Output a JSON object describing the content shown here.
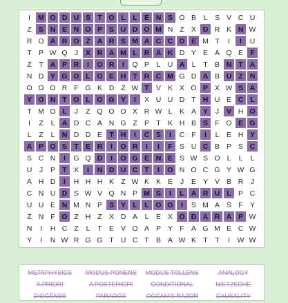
{
  "grid_rows": [
    "IMODUSTOLLENSOBLSVCU",
    "ZSNENOPSUDOMNZXDRKNW",
    "ROAROZARSMACCOEMTIIU",
    "TPWQJXRAMLRAKDYEAQEF",
    "ZTAPRIORIQPLUALTBNTA",
    "NDYGOLOEHTRCMGDABUZN",
    "OOORFGKDZWTVKXOPXWSA",
    "YONTOLOGYIXUUDTHUECL",
    "TMOLJZQOOXRWLKAYJVHO",
    "IZLADCANGZPTKHBSFOEG",
    "LZLNDDETHICSICFILEHY",
    "APOSTERIORIIFSUCBPSC",
    "SCNIGQDIOGENESWSOLLL",
    "UJPTXINDUCTIONOCGYWG",
    "AHDIHHHKZWKKEJEYVBRJ",
    "CNUDSWVQNPMSILARULPC",
    "UUENMNPSYLLOGISMASFY",
    "ZNFOZHZXDALEXODARAPW",
    "NIHCZLTEVOAPYFAGMECW",
    "YINWRGGTUCTBAWKTTIWW"
  ],
  "highlight_rows": [
    "01111111111110000000",
    "01111111111100010010",
    "00111111111111100010",
    "00000111111110000001",
    "00111111100001000111",
    "00111111111110010111",
    "00000000001000010011",
    "11111111110000010011",
    "00010000000000010101",
    "00010000000000010011",
    "00010001111110010001",
    "11111111111110010001",
    "00010011111110000000",
    "00010111111110000000",
    "00010000000000000000",
    "00010000001111111100",
    "00010001111111000000",
    "00010000000001111110",
    "00000000000000000000",
    "00000000000000000000"
  ],
  "word_list": [
    "METAPHYSICS",
    "MODUS PONENS",
    "MODUS TOLLENS",
    "ANALOGY",
    "A PRIORI",
    "A POSTERIORI",
    "CONDITIONAL",
    "NIETZSCHE",
    "DIOGENES",
    "PARADOX",
    "OCCAM'S RAZOR",
    "CAUSALITY"
  ]
}
